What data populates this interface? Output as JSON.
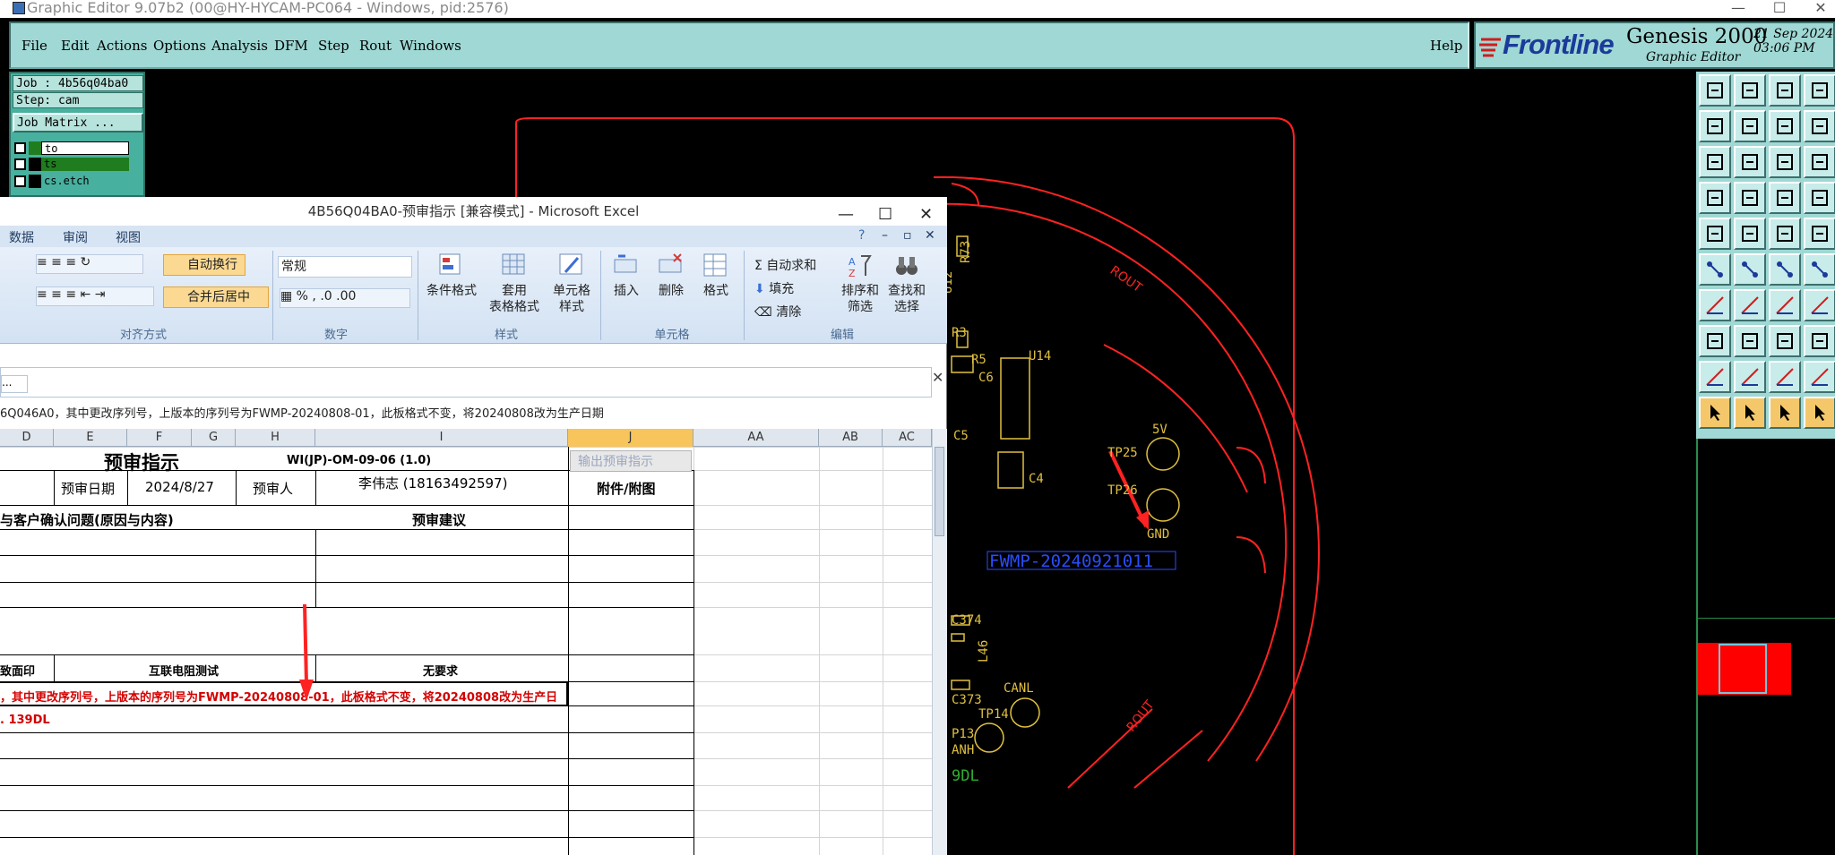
{
  "genesis": {
    "window_title": "Graphic Editor 9.07b2 (00@HY-HYCAM-PC064 - Windows, pid:2576)",
    "menu": [
      "File",
      "Edit",
      "Actions",
      "Options",
      "Analysis",
      "DFM",
      "Step",
      "Rout",
      "Windows"
    ],
    "help": "Help",
    "brand": {
      "logo": "Frontline",
      "product": "Genesis 2000",
      "subtitle": "Graphic Editor",
      "date": "21 Sep 2024",
      "time": "03:06 PM"
    },
    "job": {
      "job_line": "Job : 4b56q04ba0",
      "step_line": "Step: cam",
      "matrix_button": "Job Matrix ..."
    },
    "layers": [
      {
        "name": "to",
        "color": "#1f7d1f"
      },
      {
        "name": "ts",
        "color": "#1f7d1f"
      },
      {
        "name": "cs.etch",
        "color": "#1f7d1f"
      }
    ],
    "pcb_labels": {
      "ref": [
        "R73",
        "U12",
        "R3",
        "R5",
        "C6",
        "U14",
        "C5",
        "C4",
        "5V",
        "TP25",
        "TP26",
        "GND",
        "C374",
        "L46",
        "C373",
        "CANL",
        "TP14",
        "P13",
        "ANH",
        "9DL"
      ],
      "rout_top": "ROUT",
      "rout_bottom": "ROUT",
      "serial": "FWMP-20240921011"
    },
    "colors": {
      "outline": "#ff2222",
      "silk": "#e0c040",
      "serial": "#2a4dff"
    }
  },
  "excel": {
    "title": "4B56Q04BA0-预审指示  [兼容模式] - Microsoft Excel",
    "window_controls": {
      "min": "—",
      "max": "☐",
      "close": "✕"
    },
    "tabs": [
      "数据",
      "审阅",
      "视图"
    ],
    "ribbon": {
      "wrap_text": "自动换行",
      "merge_center": "合并后居中",
      "number_format": "常规",
      "group_align": "对齐方式",
      "group_number": "数字",
      "group_style": "样式",
      "group_cells": "单元格",
      "group_edit": "编辑",
      "cond_format": "条件格式",
      "table_format_1": "套用",
      "table_format_2": "表格格式",
      "cell_style_1": "单元格",
      "cell_style_2": "样式",
      "insert": "插入",
      "delete": "删除",
      "format": "格式",
      "autosum": "自动求和",
      "fill": "填充",
      "clear": "清除",
      "sort_1": "排序和",
      "sort_2": "筛选",
      "find_1": "查找和",
      "find_2": "选择"
    },
    "name_box": "...",
    "formula_text": "6Q046A0，其中更改序列号，上版本的序列号为FWMP-20240808-01，此板格式不变，将20240808改为生产日期",
    "columns": [
      "D",
      "E",
      "F",
      "G",
      "H",
      "I",
      "J",
      "AA",
      "AB",
      "AC"
    ],
    "cells": {
      "title": "预审指示",
      "doc_no": "WI(JP)-OM-09-06 (1.0)",
      "output_btn": "输出预审指示",
      "pre_date_label": "预审日期",
      "pre_date": "2024/8/27",
      "reviewer_label": "预审人",
      "reviewer": "李伟志 (18163492597)",
      "attach": "附件/附图",
      "confirm_issue": "与客户确认问题(原因与内容)",
      "suggest": "预审建议",
      "row_a": "致面印",
      "row_b": "互联电阻测试",
      "row_c": "无要求",
      "red_note": "，其中更改序列号，上版本的序列号为FWMP-20240808-01，此板格式不变，将20240808改为生产日",
      "red_note2": ". 139DL"
    }
  }
}
